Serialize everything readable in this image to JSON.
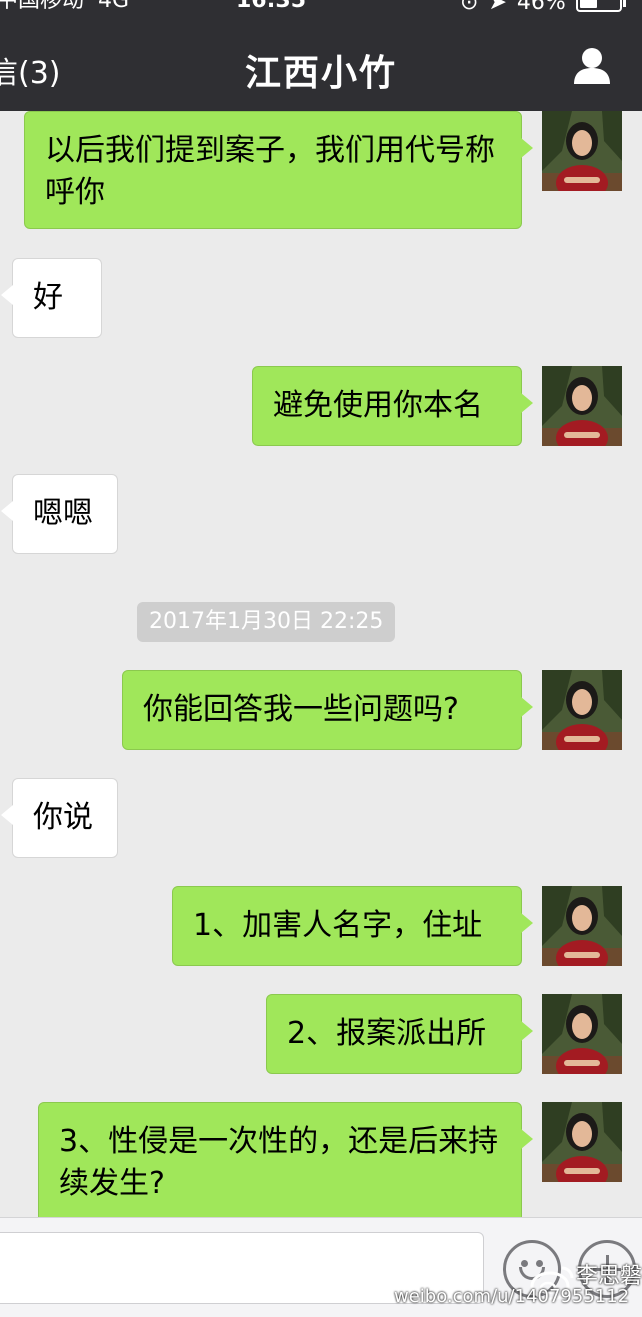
{
  "status_bar": {
    "carrier": "中国移动",
    "network": "4G",
    "time": "16:35",
    "battery": "46%",
    "battery_level": 0.46
  },
  "nav": {
    "back_label": "信(3)",
    "title": "江西小竹",
    "profile_icon": "person-icon"
  },
  "messages": [
    {
      "side": "me",
      "text": "以后我们提到案子，我们用代号称呼你"
    },
    {
      "side": "them",
      "text": "好"
    },
    {
      "side": "me",
      "text": "避免使用你本名"
    },
    {
      "side": "them",
      "text": "嗯嗯"
    },
    {
      "side": "me",
      "text": "你能回答我一些问题吗?"
    },
    {
      "side": "them",
      "text": "你说"
    },
    {
      "side": "me",
      "text": "1、加害人名字，住址"
    },
    {
      "side": "me",
      "text": "2、报案派出所"
    },
    {
      "side": "me",
      "text": "3、性侵是一次性的，还是后来持续发生?"
    }
  ],
  "timestamp": "2017年1月30日  22:25",
  "input_bar": {
    "emoji_icon": "emoji-icon",
    "plus_icon": "plus-icon"
  },
  "watermark": {
    "name": "李思磐",
    "url": "weibo.com/u/1407955112"
  },
  "colors": {
    "nav_bg": "#2f2f33",
    "my_bubble": "#a0e75a",
    "their_bubble": "#ffffff",
    "chat_bg": "#ebebeb"
  }
}
